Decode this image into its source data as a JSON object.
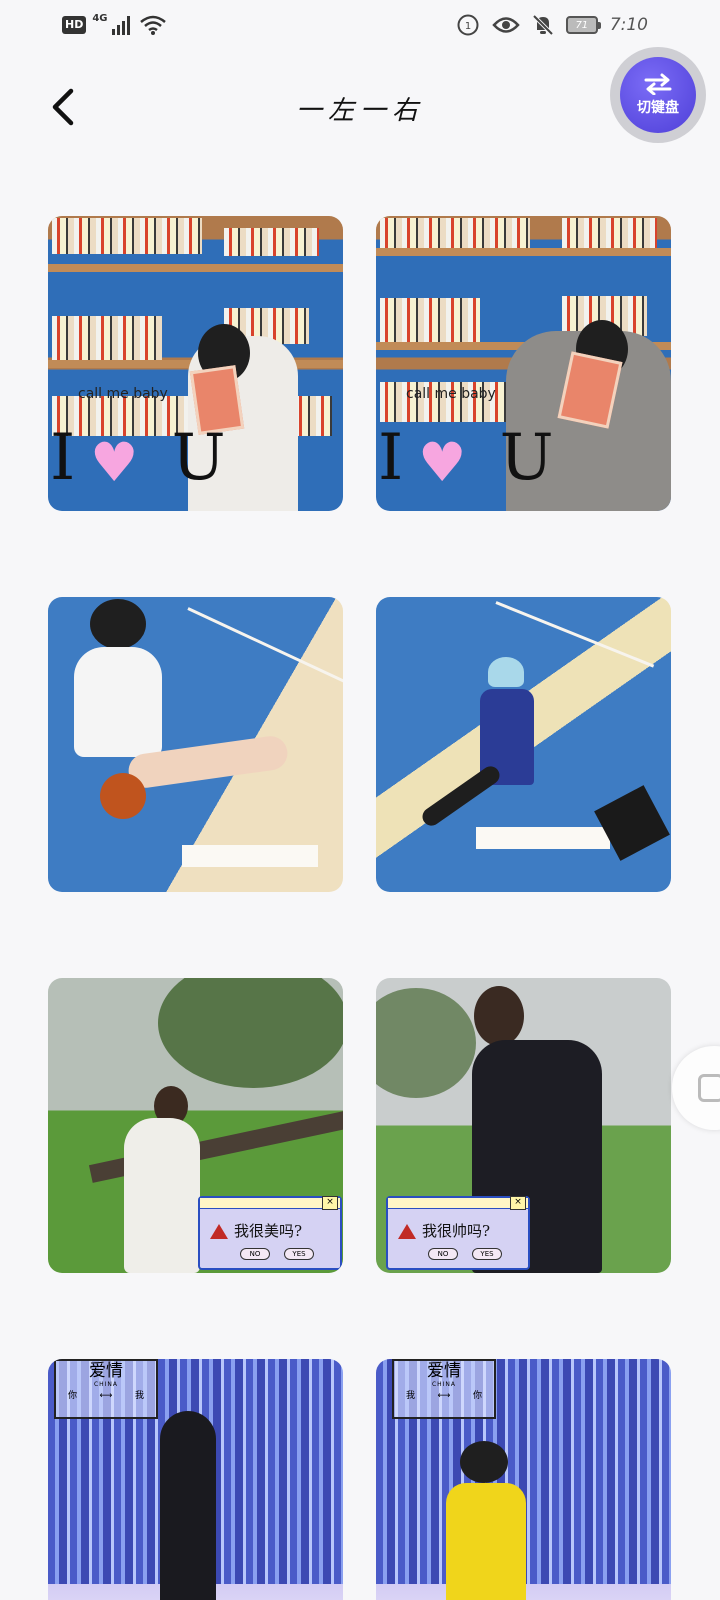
{
  "status_bar": {
    "hd": "HD",
    "network": "4G",
    "battery": "71",
    "time": "7:10"
  },
  "header": {
    "title": "一左一右",
    "keyboard_switch_label": "切键盘"
  },
  "tiles": [
    {
      "pair": 1,
      "side": "left",
      "overlay_text": "call me baby",
      "overlay_letters": "I U"
    },
    {
      "pair": 1,
      "side": "right",
      "overlay_text": "call me baby",
      "overlay_letters": "I U"
    },
    {
      "pair": 2,
      "side": "left"
    },
    {
      "pair": 2,
      "side": "right"
    },
    {
      "pair": 3,
      "side": "left",
      "dialog_question": "我很美吗?",
      "dialog_no": "NO",
      "dialog_yes": "YES"
    },
    {
      "pair": 3,
      "side": "right",
      "dialog_question": "我很帅吗?",
      "dialog_no": "NO",
      "dialog_yes": "YES"
    },
    {
      "pair": 4,
      "side": "left",
      "sign_title": "爱情",
      "sign_sub": "CHINA",
      "sign_left": "你",
      "sign_arrow": "⟷",
      "sign_right": "我"
    },
    {
      "pair": 4,
      "side": "right",
      "sign_title": "爱情",
      "sign_sub": "CHINA",
      "sign_left": "我",
      "sign_arrow": "⟷",
      "sign_right": "你"
    }
  ],
  "colors": {
    "background": "#f7f7f9",
    "keyboard_button": "#5b4ce3",
    "court_blue": "#3e7cc3",
    "curtain_blue": "#4a5bc8"
  },
  "icons": [
    "back-arrow-icon",
    "swap-icon",
    "wifi-icon",
    "signal-icon",
    "eye-icon",
    "mute-bell-icon",
    "battery-icon"
  ]
}
